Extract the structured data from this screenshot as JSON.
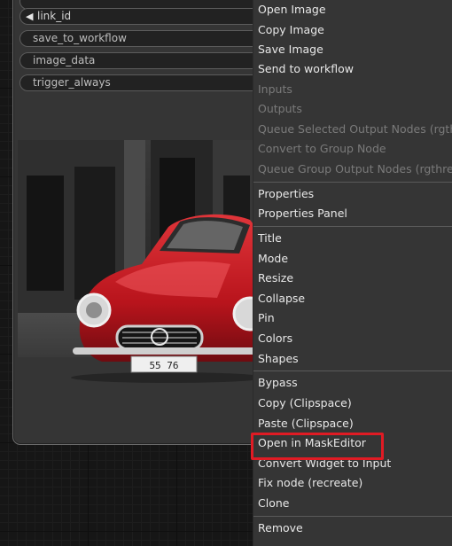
{
  "node": {
    "widgets": [
      {
        "label": "link_id",
        "linked": true
      },
      {
        "label": "save_to_workflow",
        "linked": false
      },
      {
        "label": "image_data",
        "linked": false
      },
      {
        "label": "trigger_always",
        "linked": false
      }
    ],
    "preview_plate": "55  76"
  },
  "menu": {
    "items": [
      {
        "label": "Open Image",
        "disabled": false
      },
      {
        "label": "Copy Image",
        "disabled": false
      },
      {
        "label": "Save Image",
        "disabled": false
      },
      {
        "label": "Send to workflow",
        "disabled": false
      },
      {
        "label": "Inputs",
        "disabled": true
      },
      {
        "label": "Outputs",
        "disabled": true
      },
      {
        "label": "Queue Selected Output Nodes (rgthree)",
        "disabled": true
      },
      {
        "label": "Convert to Group Node",
        "disabled": true
      },
      {
        "label": "Queue Group Output Nodes (rgthree)",
        "disabled": true
      },
      {
        "label": "Properties",
        "disabled": false
      },
      {
        "label": "Properties Panel",
        "disabled": false
      },
      {
        "label": "Title",
        "disabled": false
      },
      {
        "label": "Mode",
        "disabled": false
      },
      {
        "label": "Resize",
        "disabled": false
      },
      {
        "label": "Collapse",
        "disabled": false
      },
      {
        "label": "Pin",
        "disabled": false
      },
      {
        "label": "Colors",
        "disabled": false
      },
      {
        "label": "Shapes",
        "disabled": false
      },
      {
        "label": "Bypass",
        "disabled": false
      },
      {
        "label": "Copy (Clipspace)",
        "disabled": false
      },
      {
        "label": "Paste (Clipspace)",
        "disabled": false
      },
      {
        "label": "Open in MaskEditor",
        "disabled": false,
        "highlighted": true
      },
      {
        "label": "Convert Widget to Input",
        "disabled": false
      },
      {
        "label": "Fix node (recreate)",
        "disabled": false
      },
      {
        "label": "Clone",
        "disabled": false
      },
      {
        "label": "Remove",
        "disabled": false
      }
    ],
    "highlight_color": "#e01b24"
  },
  "colors": {
    "canvas_bg": "#161616",
    "node_bg": "#353535",
    "menu_bg": "#353535",
    "disabled_text": "#7a7a7a"
  }
}
